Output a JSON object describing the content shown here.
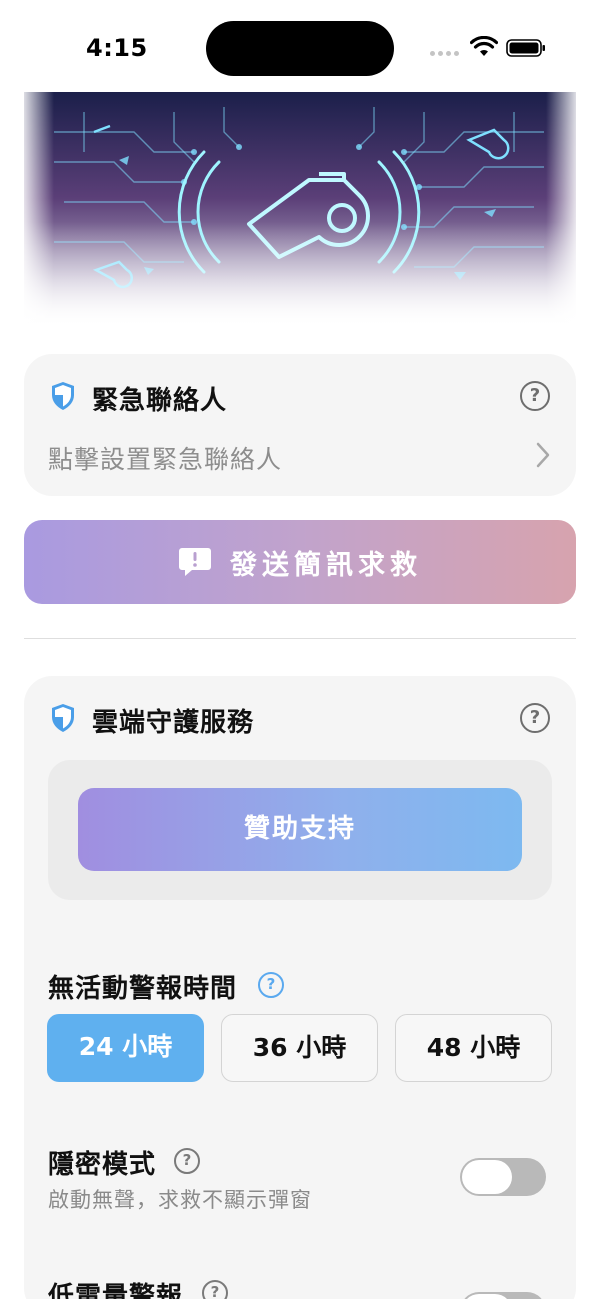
{
  "status_bar": {
    "time": "4:15"
  },
  "emergency_contacts": {
    "title": "緊急聯絡人",
    "hint": "點擊設置緊急聯絡人",
    "help": "?"
  },
  "sms_button": {
    "label": "發送簡訊求救"
  },
  "cloud_service": {
    "title": "雲端守護服務",
    "help": "?",
    "sponsor_label": "贊助支持",
    "inactivity": {
      "label": "無活動警報時間",
      "help": "?",
      "options": [
        "24 小時",
        "36 小時",
        "48 小時"
      ],
      "selected": "24 小時"
    },
    "privacy_mode": {
      "label": "隱密模式",
      "help": "?",
      "description": "啟動無聲，求救不顯示彈窗",
      "enabled": false
    },
    "low_battery": {
      "label": "低電量警報",
      "help": "?"
    }
  },
  "colors": {
    "accent_blue": "#5fb0ef",
    "sms_gradient": [
      "#a99ae0",
      "#d7a3ae"
    ],
    "sponsor_gradient": [
      "#a08ee0",
      "#7db9f0"
    ],
    "banner_neon": "#7ff0ff"
  }
}
